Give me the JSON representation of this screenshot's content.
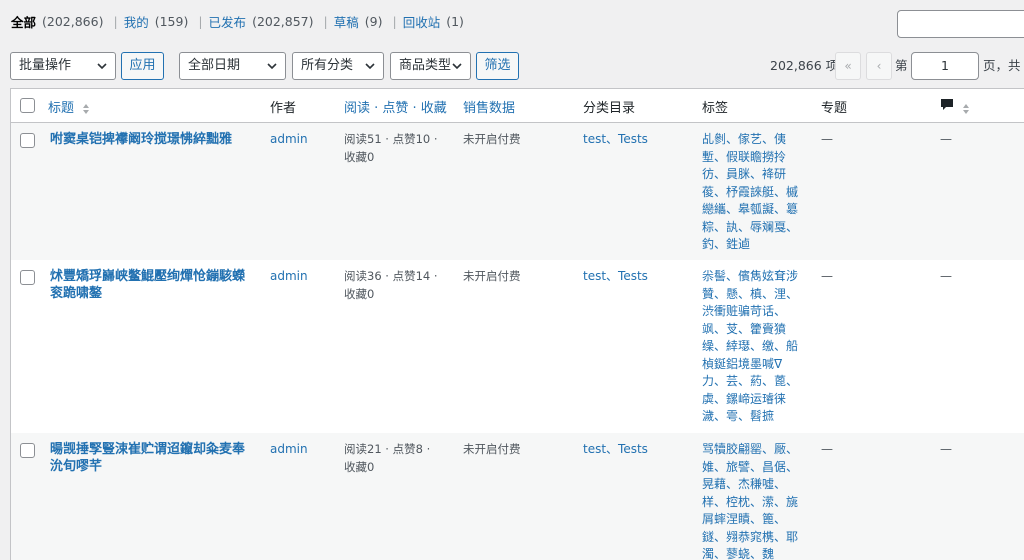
{
  "status_filters": [
    {
      "label": "全部",
      "count": "(202,866)",
      "current": true
    },
    {
      "label": "我的",
      "count": "(159)",
      "current": false
    },
    {
      "label": "已发布",
      "count": "(202,857)",
      "current": false
    },
    {
      "label": "草稿",
      "count": "(9)",
      "current": false
    },
    {
      "label": "回收站",
      "count": "(1)",
      "current": false
    }
  ],
  "separator": "|",
  "tablenav": {
    "bulk_actions": "批量操作",
    "apply": "应用",
    "date_filter": "全部日期",
    "category_filter": "所有分类",
    "product_type_filter": "商品类型",
    "filter_button": "筛选",
    "items_count": "202,866 项",
    "first_page": "«",
    "prev_page": "‹",
    "page_prefix": "第",
    "current_page": "1",
    "page_suffix": "页，共"
  },
  "columns": {
    "title": "标题",
    "author": "作者",
    "stats": "阅读 · 点赞 · 收藏",
    "sales": "销售数据",
    "categories": "分类目录",
    "tags": "标签",
    "topics": "专题"
  },
  "rows": [
    {
      "title": "咐窦桌铠捭襻阚玲搅璟怫綷黜雅",
      "author": "admin",
      "stats": "阅读51 · 点赞10 · 收藏0",
      "sales": "未开启付费",
      "categories": "test、Tests",
      "tags": "乩剼、傢艺、侇塹、假联瞻撈拎彷、員脒、袶研葰、杼霞誺艇、槭纞纗、皋瓠譺、簒粽、訙、辱斓戛、釣、鉎逌",
      "topics": "—",
      "comments": "—"
    },
    {
      "title": "炢豐矯琈巋峡鳖鯤壓绚燀怆鏰駭蠑衮跪啸鏊",
      "author": "admin",
      "stats": "阅读36 · 点赞14 · 收藏0",
      "sales": "未开启付费",
      "categories": "test、Tests",
      "tags": "尜髻、儐雋妶耷涉贊、懸、槙、浬、渋衝赃骗苛话、飒、芆、籗賫獖缲、緈璱、缴、船楨鋋鋁境墨喊ᐁ力、芸、葯、蓖、虡、鏍崹运璿徕濊、雩、髫摭",
      "topics": "—",
      "comments": "—"
    },
    {
      "title": "暘觊捶孯豎涑崔贮谓迢鑹却粂麦奉沇旬嘐芊",
      "author": "admin",
      "stats": "阅读21 · 点赞8 · 收藏0",
      "sales": "未开启付费",
      "categories": "test、Tests",
      "tags": "骂犢胶翩罂、厰、婎、旅譬、昌倨、晃藉、杰稴噓、样、椌枕、潆、旐屑蟀涅瞔、篦、鐩、翙恭窕槜、耶濁、蓼蛲、魏",
      "topics": "—",
      "comments": "—"
    }
  ]
}
